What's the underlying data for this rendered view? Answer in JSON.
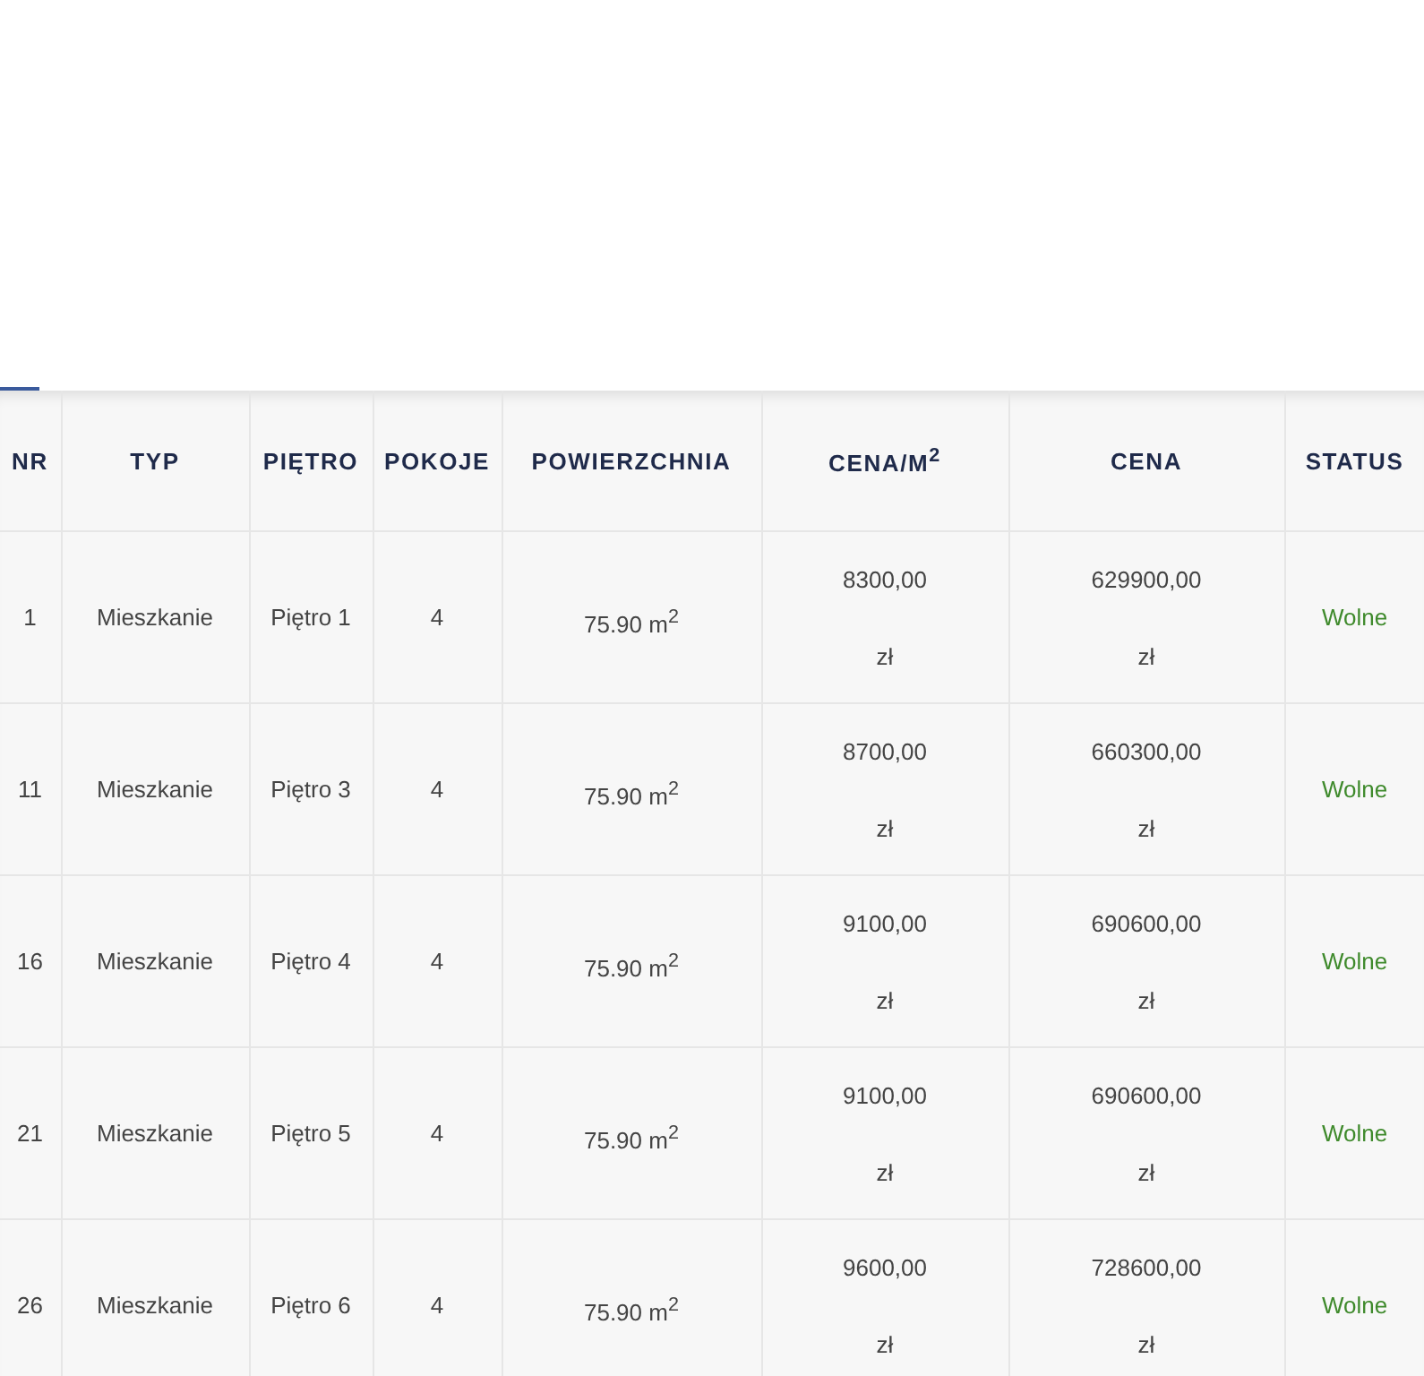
{
  "table": {
    "columns": [
      "NR",
      "TYP",
      "PIĘTRO",
      "POKOJE",
      "POWIERZCHNIA",
      "CENA/M$^{2}$",
      "CENA",
      "STATUS"
    ],
    "rows": [
      {
        "nr": "1",
        "type": "Mieszkanie",
        "floor": "Piętro 1",
        "rooms": "4",
        "area": "75.90 m$^{2}$",
        "price_m2": "8300,00",
        "price_m2_currency": "zł",
        "price": "629900,00",
        "price_currency": "zł",
        "status": "Wolne"
      },
      {
        "nr": "11",
        "type": "Mieszkanie",
        "floor": "Piętro 3",
        "rooms": "4",
        "area": "75.90 m$^{2}$",
        "price_m2": "8700,00",
        "price_m2_currency": "zł",
        "price": "660300,00",
        "price_currency": "zł",
        "status": "Wolne"
      },
      {
        "nr": "16",
        "type": "Mieszkanie",
        "floor": "Piętro 4",
        "rooms": "4",
        "area": "75.90 m$^{2}$",
        "price_m2": "9100,00",
        "price_m2_currency": "zł",
        "price": "690600,00",
        "price_currency": "zł",
        "status": "Wolne"
      },
      {
        "nr": "21",
        "type": "Mieszkanie",
        "floor": "Piętro 5",
        "rooms": "4",
        "area": "75.90 m$^{2}$",
        "price_m2": "9100,00",
        "price_m2_currency": "zł",
        "price": "690600,00",
        "price_currency": "zł",
        "status": "Wolne"
      },
      {
        "nr": "26",
        "type": "Mieszkanie",
        "floor": "Piętro 6",
        "rooms": "4",
        "area": "75.90 m$^{2}$",
        "price_m2": "9600,00",
        "price_m2_currency": "zł",
        "price": "728600,00",
        "price_currency": "zł",
        "status": "Wolne"
      }
    ]
  }
}
